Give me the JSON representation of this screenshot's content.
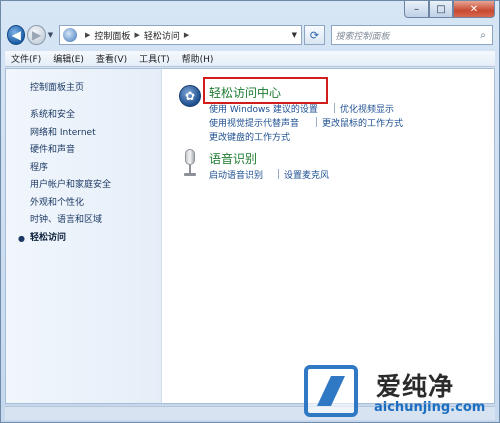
{
  "address": {
    "crumbs": [
      "控制面板",
      "轻松访问"
    ]
  },
  "search": {
    "placeholder": "搜索控制面板"
  },
  "menu": [
    "文件(F)",
    "编辑(E)",
    "查看(V)",
    "工具(T)",
    "帮助(H)"
  ],
  "sidebar": {
    "home": "控制面板主页",
    "items": [
      "系统和安全",
      "网络和 Internet",
      "硬件和声音",
      "程序",
      "用户帐户和家庭安全",
      "外观和个性化",
      "时钟、语言和区域"
    ],
    "current": "轻松访问"
  },
  "sections": [
    {
      "title": "轻松访问中心",
      "icon": "ease-of-access-icon",
      "links": [
        "使用 Windows 建议的设置",
        "优化视频显示",
        "使用视觉提示代替声音",
        "更改鼠标的工作方式",
        "更改键盘的工作方式"
      ]
    },
    {
      "title": "语音识别",
      "icon": "microphone-icon",
      "links": [
        "启动语音识别",
        "设置麦克风"
      ]
    }
  ],
  "watermark": {
    "cn": "爱纯净",
    "en": "aichunjing.com"
  },
  "colors": {
    "highlight": "#d21d1d",
    "section_title": "#1d7b2f",
    "link": "#1d4f91"
  }
}
